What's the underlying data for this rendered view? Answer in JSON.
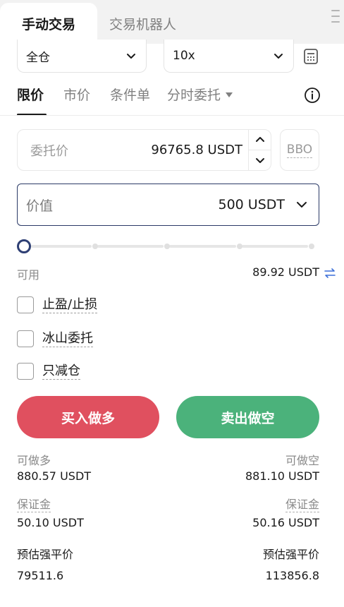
{
  "tabs": {
    "manual": "手动交易",
    "bot": "交易机器人"
  },
  "margin_mode": "全仓",
  "leverage": "10x",
  "order_types": [
    "限价",
    "市价",
    "条件单",
    "分时委托"
  ],
  "price_field": {
    "label": "委托价",
    "value": "96765.8 USDT"
  },
  "bbo_label": "BBO",
  "value_field": {
    "label": "价值",
    "value": "500 USDT"
  },
  "slider": {
    "percent": 0
  },
  "available": {
    "label": "可用",
    "value": "89.92 USDT"
  },
  "options": [
    "止盈/止损",
    "冰山委托",
    "只减仓"
  ],
  "buttons": {
    "long": "买入做多",
    "short": "卖出做空"
  },
  "stats": {
    "max_long_label": "可做多",
    "max_long": "880.57 USDT",
    "max_short_label": "可做空",
    "max_short": "881.10 USDT",
    "margin_label": "保证金",
    "margin_long": "50.10 USDT",
    "margin_short": "50.16 USDT",
    "liq_label": "预估强平价",
    "liq_long": "79511.6",
    "liq_short": "113856.8"
  },
  "colors": {
    "long": "#e0505f",
    "short": "#4bb27b",
    "accent": "#2e3f74"
  }
}
